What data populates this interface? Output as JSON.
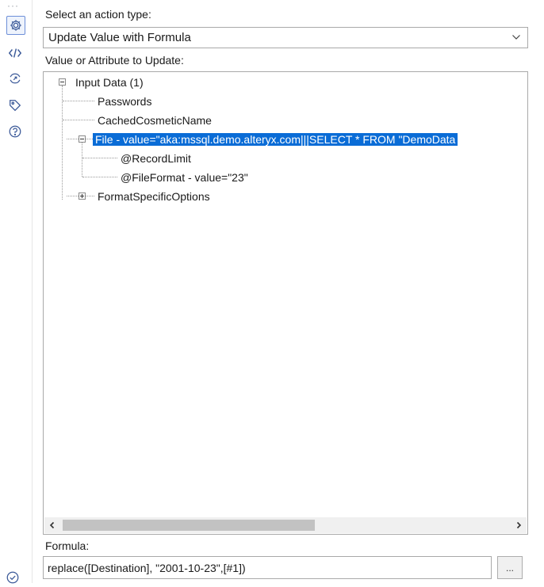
{
  "rail": {
    "dots": "···",
    "icons": [
      "gear-icon",
      "code-icon",
      "connection-icon",
      "tag-icon",
      "help-icon",
      "check-circle-icon"
    ]
  },
  "action": {
    "label": "Select an action type:",
    "selected": "Update Value with Formula"
  },
  "tree": {
    "label": "Value or Attribute to Update:",
    "nodes": [
      "Input Data (1)",
      "Passwords",
      "CachedCosmeticName",
      "File - value=\"aka:mssql.demo.alteryx.com|||SELECT * FROM \"DemoData",
      "@RecordLimit",
      "@FileFormat - value=\"23\"",
      "FormatSpecificOptions"
    ]
  },
  "formula": {
    "label": "Formula:",
    "value": "replace([Destination], \"2001-10-23\",[#1])",
    "button_label": "..."
  },
  "colors": {
    "selection": "#0a6cd6",
    "accent": "#3c5a99"
  }
}
